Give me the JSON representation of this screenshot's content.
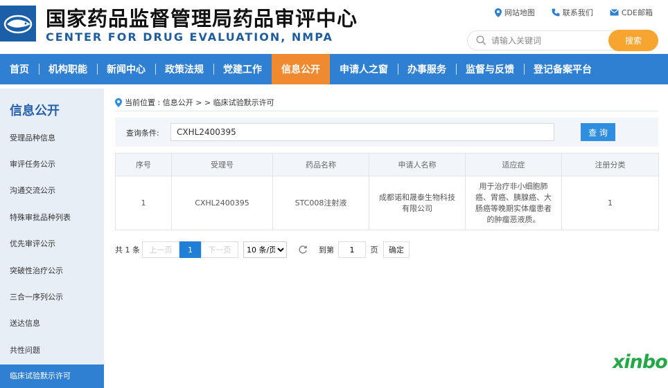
{
  "header": {
    "title_cn": "国家药品监督管理局药品审评中心",
    "title_en": "CENTER FOR DRUG EVALUATION, NMPA",
    "links": [
      {
        "label": "网站地图",
        "icon": "location-pin-icon"
      },
      {
        "label": "联系我们",
        "icon": "phone-icon"
      },
      {
        "label": "CDE邮箱",
        "icon": "mail-icon"
      }
    ],
    "search_placeholder": "请输入关键词",
    "search_button": "搜索"
  },
  "nav": {
    "items": [
      "首页",
      "机构职能",
      "新闻中心",
      "政策法规",
      "党建工作",
      "信息公开",
      "申请人之窗",
      "办事服务",
      "监督与反馈",
      "登记备案平台"
    ],
    "active": "信息公开",
    "color": "#2f7fd3",
    "active_color": "#ef8a30"
  },
  "sidebar": {
    "title": "信息公开",
    "items": [
      "受理品种信息",
      "审评任务公示",
      "沟通交流公示",
      "特殊审批品种列表",
      "优先审评公示",
      "突破性治疗公示",
      "三合一序列公示",
      "送达信息",
      "共性问题",
      "临床试验默示许可"
    ],
    "active": "临床试验默示许可"
  },
  "breadcrumb": {
    "text": "当前位置 : 信息公开 > > 临床试验默示许可"
  },
  "query": {
    "label": "查询条件:",
    "value": "CXHL2400395",
    "button": "查 询"
  },
  "table": {
    "headers": [
      "序号",
      "受理号",
      "药品名称",
      "申请人名称",
      "适应症",
      "注册分类"
    ],
    "rows": [
      [
        "1",
        "CXHL2400395",
        "STC008注射液",
        "成都诺和晟泰生物科技有限公司",
        "用于治疗非小细胞肺癌、胃癌、胰腺癌、大肠癌等晚期实体瘤患者的肿瘤恶液质。",
        "1"
      ]
    ]
  },
  "pager": {
    "total": "共 1 条",
    "prev": "上一页",
    "current": "1",
    "next": "下一页",
    "page_size": "10 条/页",
    "goto_label": "到第",
    "goto_value": "1",
    "page_unit": "页",
    "confirm": "确定"
  },
  "watermark": "xinbo"
}
